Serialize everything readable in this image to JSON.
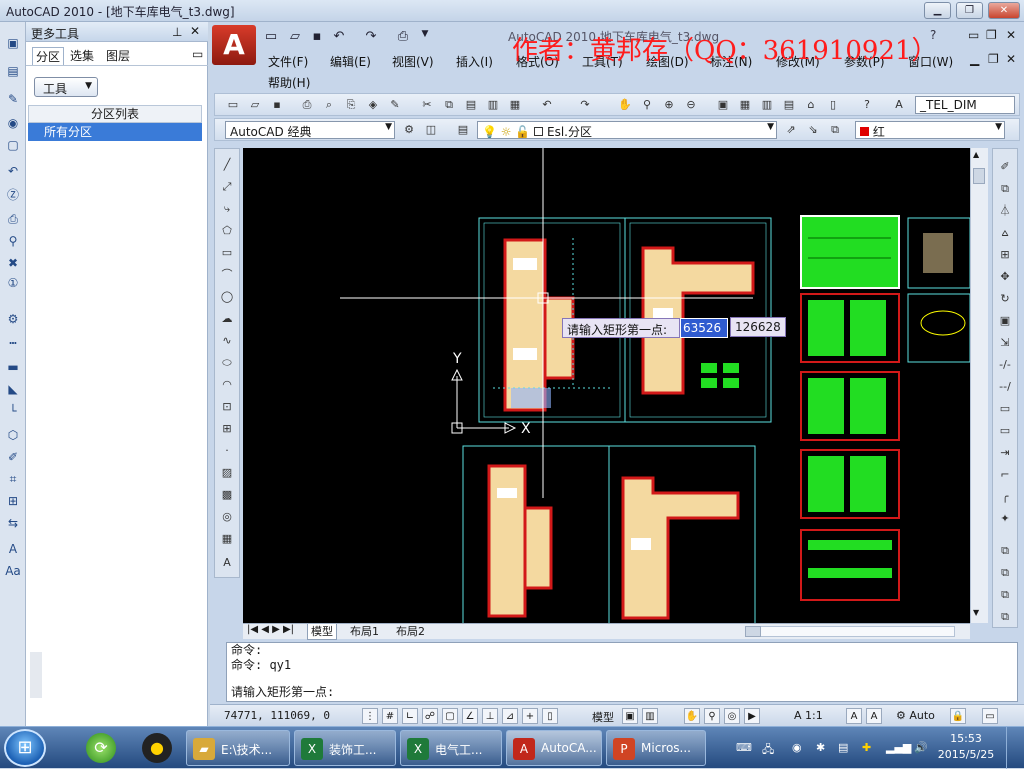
{
  "window": {
    "title": "AutoCAD 2010 - [地下车库电气_t3.dwg]",
    "inner_title": "AutoCAD 2010   地下车库电气_t3.dwg"
  },
  "left_panel": {
    "title": "更多工具",
    "tabs": [
      "分区",
      "选集",
      "图层"
    ],
    "tools_button": "工具",
    "list_header": "分区列表",
    "list_items": [
      "所有分区"
    ]
  },
  "menu": [
    "文件(F)",
    "编辑(E)",
    "视图(V)",
    "插入(I)",
    "格式(O)",
    "工具(T)",
    "绘图(D)",
    "标注(N)",
    "修改(M)",
    "参数(P)",
    "窗口(W)",
    "帮助(H)"
  ],
  "watermark": "作者：黄邦存（QQ：361910921）",
  "toolbar": {
    "text_style": "_TEL_DIM",
    "workspace": "AutoCAD 经典",
    "layer": "Esl.分区",
    "color": "红"
  },
  "layout_tabs": [
    "模型",
    "布局1",
    "布局2"
  ],
  "tooltip": {
    "prompt": "请输入矩形第一点:",
    "x_value": "63526",
    "y_value": "126628"
  },
  "command_lines": [
    "命令:",
    "命令: qy1",
    "请输入矩形第一点:"
  ],
  "status": {
    "coords": "74771,  111069, 0",
    "model": "模型",
    "scale": "A 1:1",
    "auto": "Auto"
  },
  "taskbar": {
    "buttons": [
      "E:\\技术...",
      "装饰工...",
      "电气工...",
      "AutoCA...",
      "Micros..."
    ],
    "time": "15:53",
    "date": "2015/5/25"
  },
  "colors": {
    "canvas": "#000000",
    "accent_red": "#ff1c1c",
    "plan_fill": "#f4d9a0",
    "frame_cyan": "#5ce0e0",
    "sheet_green": "#22dd22"
  }
}
